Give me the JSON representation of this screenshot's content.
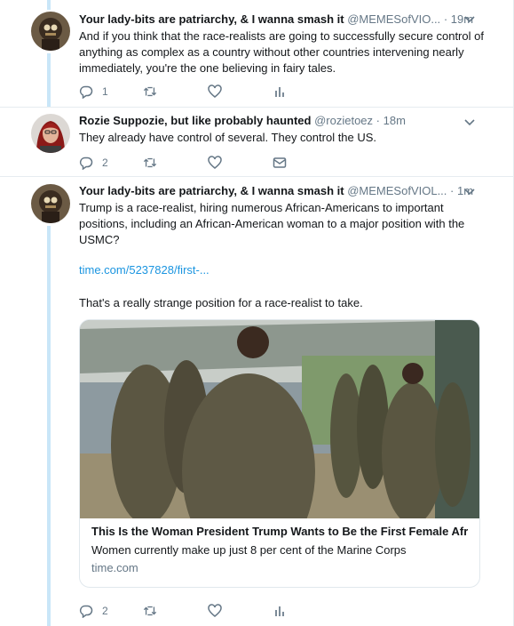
{
  "colors": {
    "accent": "#1b95e0",
    "muted": "#657786",
    "thread": "#c9e6f8",
    "border": "#e6ecf0"
  },
  "tweets": [
    {
      "name": "Your lady-bits are patriarchy, & I wanna smash it",
      "handle": "@MEMESofVIO...",
      "dot": "·",
      "time": "19m",
      "text": "And if you think that the race-realists are going to successfully secure control of anything as complex as a country without other countries intervening nearly immediately, you're the one believing in fairy tales.",
      "reply_count": "1",
      "fourth_action": "analytics-icon"
    },
    {
      "name": "Rozie Suppozie, but like probably haunted",
      "handle": "@rozietoez",
      "dot": "·",
      "time": "18m",
      "text": "They already have control of several. They control the US.",
      "reply_count": "2",
      "fourth_action": "direct-message-icon"
    },
    {
      "name": "Your lady-bits are patriarchy, & I wanna smash it",
      "handle": "@MEMESofVIOL...",
      "dot": "·",
      "time": "1m",
      "text": "Trump is a race-realist, hiring numerous African-Americans to important positions, including an African-American woman to a major position with the USMC?",
      "link": "time.com/5237828/first-...",
      "text2": "That's a really strange position for a race-realist to take.",
      "reply_count": "2",
      "fourth_action": "analytics-icon",
      "card": {
        "title": "This Is the Woman President Trump Wants to Be the First Female Afr...",
        "description": "Women currently make up just 8 per cent of the Marine Corps",
        "domain": "time.com"
      }
    }
  ]
}
